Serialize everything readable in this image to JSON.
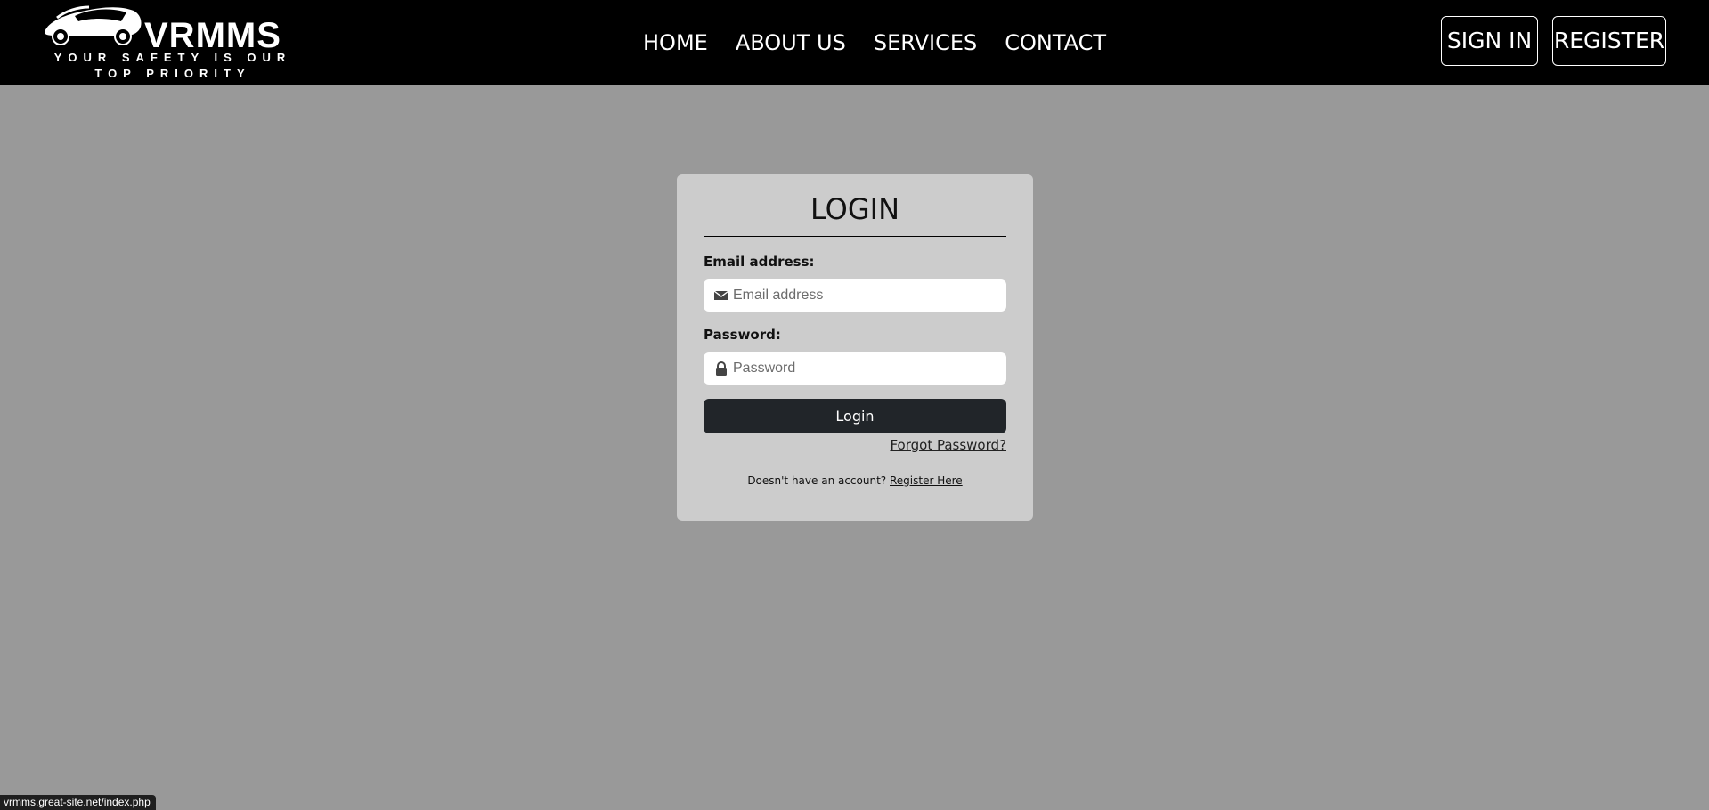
{
  "brand": {
    "name": "VRMMS",
    "tagline": "YOUR SAFETY IS OUR TOP PRIORITY"
  },
  "nav": {
    "links": [
      "HOME",
      "ABOUT US",
      "SERVICES",
      "CONTACT"
    ],
    "sign_in": "SIGN IN",
    "register": "REGISTER"
  },
  "login": {
    "title": "LOGIN",
    "email_label": "Email address:",
    "email_placeholder": "Email address",
    "email_icon": "envelope-icon",
    "password_label": "Password:",
    "password_placeholder": "Password",
    "password_icon": "lock-icon",
    "button": "Login",
    "forgot": "Forgot Password?",
    "no_account_text": "Doesn't have an account?",
    "register_link": "Register Here"
  },
  "status_bar": {
    "url": "vrmms.great-site.net/index.php"
  },
  "colors": {
    "navbar_bg": "#000000",
    "page_bg": "#999999",
    "card_bg": "#cccccc",
    "button_bg": "#212529"
  }
}
